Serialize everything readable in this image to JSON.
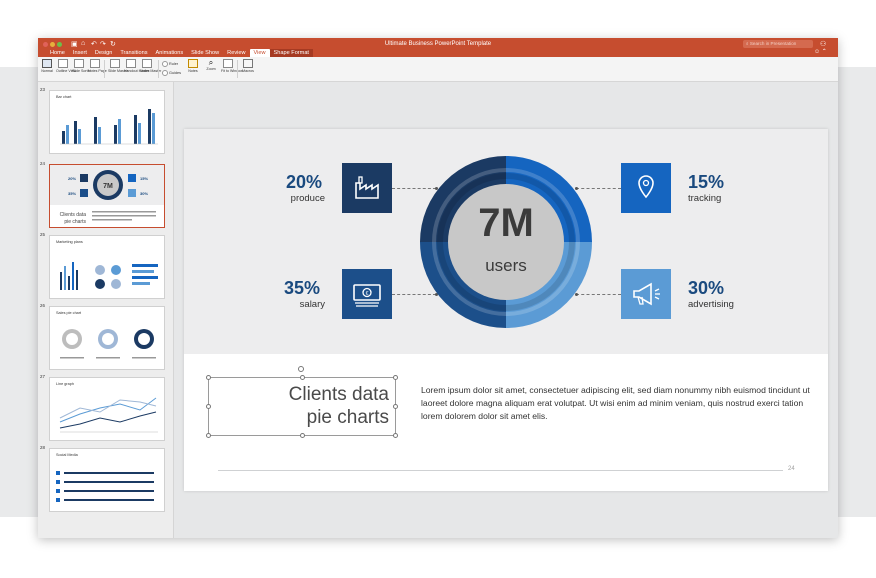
{
  "app": {
    "doc_title": "Ultimate Business PowerPoint Template",
    "search_placeholder": "Search in Presentation",
    "tabs": [
      {
        "label": "Home"
      },
      {
        "label": "Insert"
      },
      {
        "label": "Design"
      },
      {
        "label": "Transitions"
      },
      {
        "label": "Animations"
      },
      {
        "label": "Slide Show"
      },
      {
        "label": "Review"
      },
      {
        "label": "View"
      },
      {
        "label": "Shape Format"
      }
    ],
    "active_tab": "View",
    "colors": {
      "brand": "#c64d2f",
      "navy": "#1b3a63",
      "blue": "#1565c0",
      "light_blue": "#5b9bd5"
    }
  },
  "ribbon": {
    "buttons": [
      {
        "label": "Normal"
      },
      {
        "label": "Outline View"
      },
      {
        "label": "Slide Sorter"
      },
      {
        "label": "Notes Page"
      },
      {
        "label": "Slide Master"
      },
      {
        "label": "Handout Master"
      },
      {
        "label": "Notes Master"
      }
    ],
    "checks": [
      {
        "label": "Ruler"
      },
      {
        "label": "Guides"
      }
    ],
    "buttons2": [
      {
        "label": "Notes"
      },
      {
        "label": "Zoom"
      },
      {
        "label": "Fit to Window"
      },
      {
        "label": "Macros"
      }
    ]
  },
  "thumbnails": [
    {
      "num": "23",
      "title": "Bar chart"
    },
    {
      "num": "24",
      "title": "",
      "selected": true
    },
    {
      "num": "25",
      "title": "Marketing plans"
    },
    {
      "num": "26",
      "title": "Sales pie chart"
    },
    {
      "num": "27",
      "title": "Line graph"
    },
    {
      "num": "28",
      "title": "Social Media"
    }
  ],
  "slide": {
    "center_value": "7M",
    "center_label": "users",
    "stats": [
      {
        "pct": "20%",
        "label": "produce",
        "icon": "factory-icon",
        "color": "#1b3a63"
      },
      {
        "pct": "35%",
        "label": "salary",
        "icon": "money-icon",
        "color": "#1c4f8a"
      },
      {
        "pct": "15%",
        "label": "tracking",
        "icon": "location-pin-icon",
        "color": "#1565c0"
      },
      {
        "pct": "30%",
        "label": "advertising",
        "icon": "megaphone-icon",
        "color": "#5b9bd5"
      }
    ],
    "title_line1": "Clients data",
    "title_line2": "pie charts",
    "body": "Lorem ipsum dolor sit amet, consectetuer adipiscing elit, sed diam nonummy nibh euismod tincidunt ut laoreet dolore magna aliquam erat volutpat. Ut wisi enim ad minim veniam, quis nostrud exerci tation lorem dolorem dolor sit amet elis.",
    "page_number": "24"
  }
}
